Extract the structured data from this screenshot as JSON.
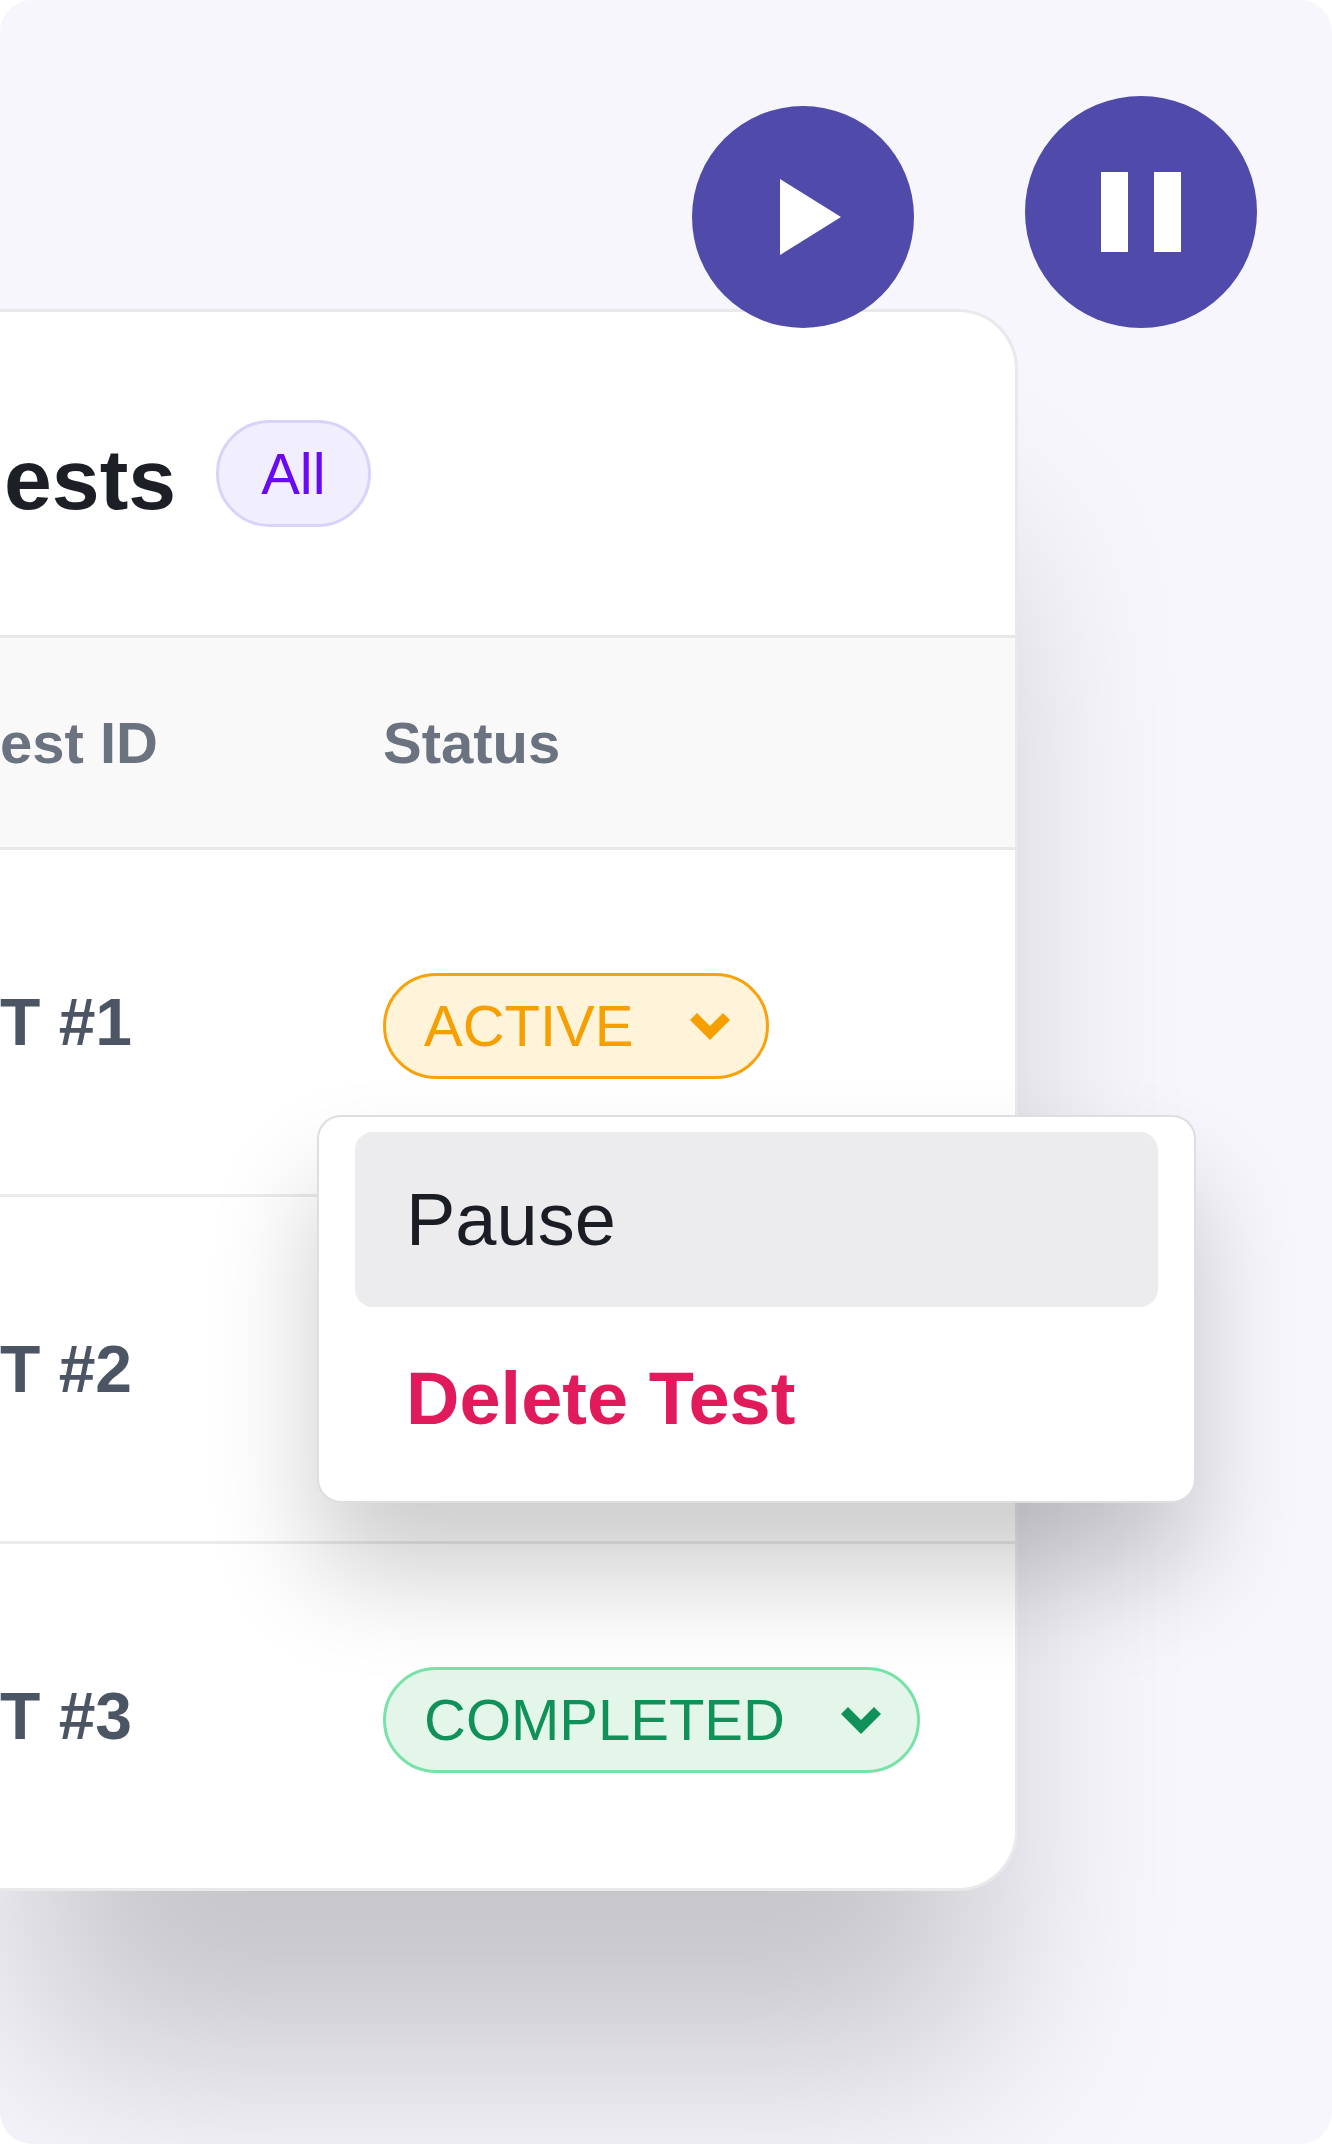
{
  "media_buttons": [
    {
      "kind": "play"
    },
    {
      "kind": "pause"
    }
  ],
  "card": {
    "title": "ests",
    "filter_chip": "All",
    "table": {
      "columns": [
        "est ID",
        "Status"
      ],
      "rows": [
        {
          "id": "T #1",
          "status": {
            "label": "ACTIVE",
            "kind": "active"
          }
        },
        {
          "id": "T #2"
        },
        {
          "id": "T #3",
          "status": {
            "label": "COMPLETED",
            "kind": "completed"
          }
        }
      ]
    }
  },
  "dropdown_menu": {
    "items": [
      {
        "label": "Pause",
        "kind": "normal",
        "selected": true
      },
      {
        "label": "Delete Test",
        "kind": "destructive",
        "selected": false
      }
    ]
  }
}
